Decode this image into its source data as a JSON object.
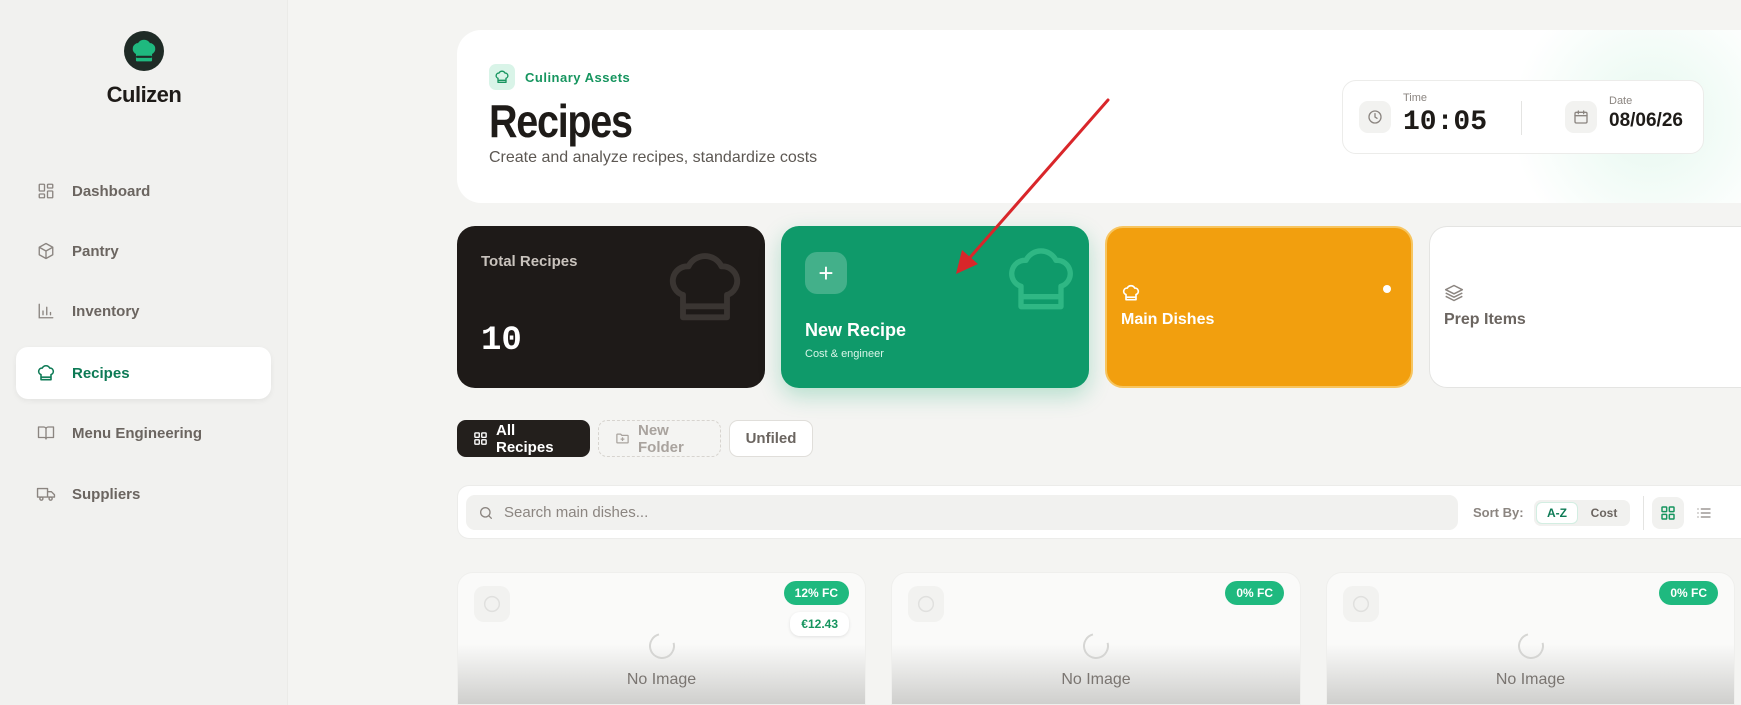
{
  "brand": {
    "name": "Culizen"
  },
  "sidebar": {
    "items": [
      {
        "label": "Dashboard",
        "icon": "dashboard-icon"
      },
      {
        "label": "Pantry",
        "icon": "box-icon"
      },
      {
        "label": "Inventory",
        "icon": "bar-chart-icon"
      },
      {
        "label": "Recipes",
        "icon": "chef-hat-icon",
        "active": true
      },
      {
        "label": "Menu Engineering",
        "icon": "book-icon"
      },
      {
        "label": "Suppliers",
        "icon": "truck-icon"
      }
    ]
  },
  "header": {
    "eyebrow": "Culinary Assets",
    "title": "Recipes",
    "subtitle": "Create and analyze recipes, standardize costs",
    "time_label": "Time",
    "time_value": "10:05",
    "date_label": "Date",
    "date_value": "08/06/26"
  },
  "cards": {
    "total": {
      "label": "Total Recipes",
      "value": "10"
    },
    "new": {
      "label": "New Recipe",
      "sublabel": "Cost & engineer"
    },
    "main": {
      "label": "Main Dishes"
    },
    "prep": {
      "label": "Prep Items"
    }
  },
  "tabs": {
    "all": "All Recipes",
    "new_folder": "New Folder",
    "unfiled": "Unfiled"
  },
  "toolbar": {
    "search_placeholder": "Search main dishes...",
    "sort_label": "Sort By:",
    "sort_az": "A-Z",
    "sort_cost": "Cost"
  },
  "recipes": [
    {
      "fc": "12% FC",
      "price": "€12.43",
      "image_text": "No Image"
    },
    {
      "fc": "0% FC",
      "image_text": "No Image"
    },
    {
      "fc": "0% FC",
      "image_text": "No Image"
    }
  ],
  "colors": {
    "accent": "#0f9a6a",
    "dark": "#1e1a18",
    "amber": "#f29f0e",
    "arrow": "#d9262a"
  }
}
